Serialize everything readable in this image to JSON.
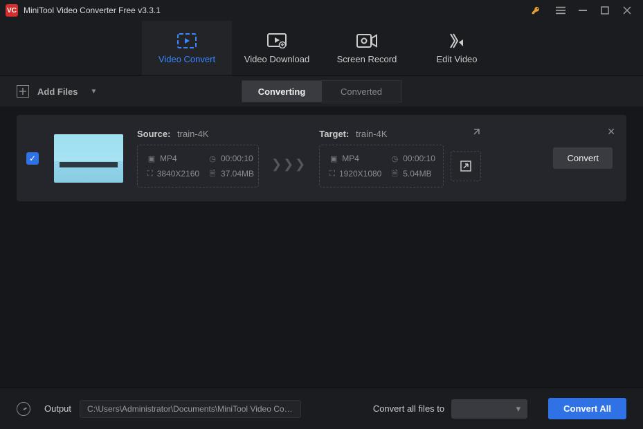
{
  "app": {
    "title": "MiniTool Video Converter Free v3.3.1"
  },
  "nav": {
    "items": [
      {
        "label": "Video Convert"
      },
      {
        "label": "Video Download"
      },
      {
        "label": "Screen Record"
      },
      {
        "label": "Edit Video"
      }
    ]
  },
  "toolbar": {
    "add_files": "Add Files",
    "converting": "Converting",
    "converted": "Converted"
  },
  "task": {
    "source_label": "Source:",
    "source_name": "train-4K",
    "source": {
      "format": "MP4",
      "duration": "00:00:10",
      "resolution": "3840X2160",
      "size": "37.04MB"
    },
    "target_label": "Target:",
    "target_name": "train-4K",
    "target": {
      "format": "MP4",
      "duration": "00:00:10",
      "resolution": "1920X1080",
      "size": "5.04MB"
    },
    "convert_btn": "Convert"
  },
  "footer": {
    "output_label": "Output",
    "output_path": "C:\\Users\\Administrator\\Documents\\MiniTool Video Converter'",
    "convert_all_files_to": "Convert all files to",
    "convert_all_btn": "Convert All"
  }
}
